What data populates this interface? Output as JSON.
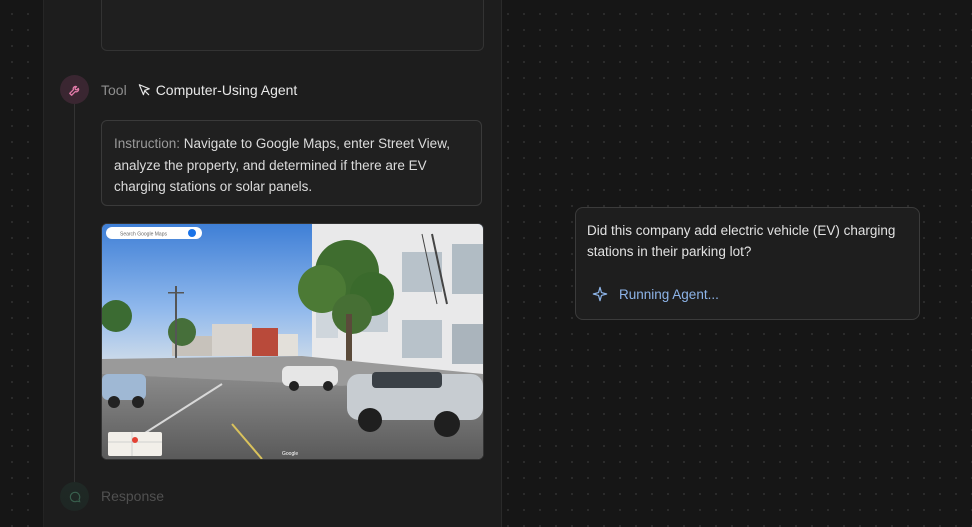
{
  "tool_step": {
    "label": "Tool",
    "agent_name": "Computer-Using Agent",
    "icon": "wrench-icon",
    "agent_icon": "cursor-icon"
  },
  "instruction": {
    "prefix": "Instruction:",
    "text": "Navigate to Google Maps, enter Street View, analyze the property, and determined if there are EV charging stations or solar panels."
  },
  "screenshot": {
    "search_placeholder": "Search Google Maps",
    "watermark": "Google"
  },
  "response_step": {
    "label": "Response",
    "icon": "chat-bubble-icon"
  },
  "chat": {
    "question": "Did this company add electric vehicle (EV) charging stations in their parking lot?",
    "status": "Running Agent...",
    "status_icon": "sparkle-icon"
  },
  "colors": {
    "background": "#161616",
    "panel": "#1d1d1d",
    "tool_accent": "#e07aa8",
    "status_blue": "#8db4e8"
  }
}
